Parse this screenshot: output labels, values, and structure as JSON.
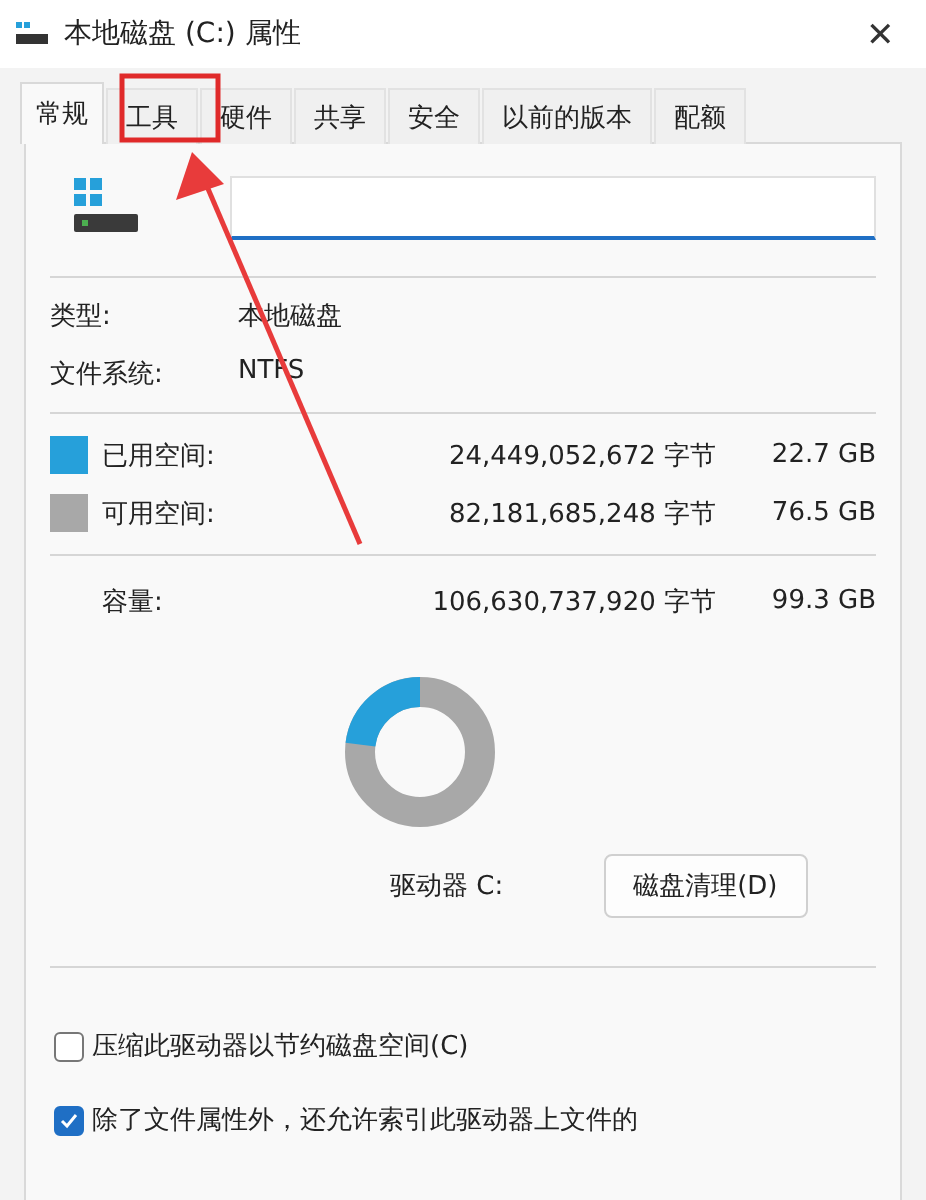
{
  "window": {
    "title": "本地磁盘 (C:) 属性",
    "close": "✕"
  },
  "tabs": [
    {
      "label": "常规",
      "selected": true
    },
    {
      "label": "工具",
      "selected": false
    },
    {
      "label": "硬件",
      "selected": false
    },
    {
      "label": "共享",
      "selected": false
    },
    {
      "label": "安全",
      "selected": false
    },
    {
      "label": "以前的版本",
      "selected": false
    },
    {
      "label": "配额",
      "selected": false
    }
  ],
  "info": [
    {
      "label": "类型:",
      "value": "本地磁盘"
    },
    {
      "label": "文件系统:",
      "value": "NTFS"
    }
  ],
  "space": [
    {
      "label": "已用空间:",
      "bytes": "24,449,052,672 字节",
      "size": "22.7 GB",
      "color": "#26a0da"
    },
    {
      "label": "可用空间:",
      "bytes": "82,181,685,248 字节",
      "size": "76.5 GB",
      "color": "#a8a8a8"
    }
  ],
  "capacity": {
    "label": "容量:",
    "bytes": "106,630,737,920 字节",
    "size": "99.3 GB"
  },
  "usage": {
    "level": 0.23
  },
  "drive_label": "驱动器 C:",
  "cleanup_button": "磁盘清理(D)",
  "options": [
    {
      "label": "压缩此驱动器以节约磁盘空间(C)",
      "checked": false
    },
    {
      "label": "除了文件属性外，还允许索引此驱动器上文件的",
      "checked": true
    }
  ]
}
